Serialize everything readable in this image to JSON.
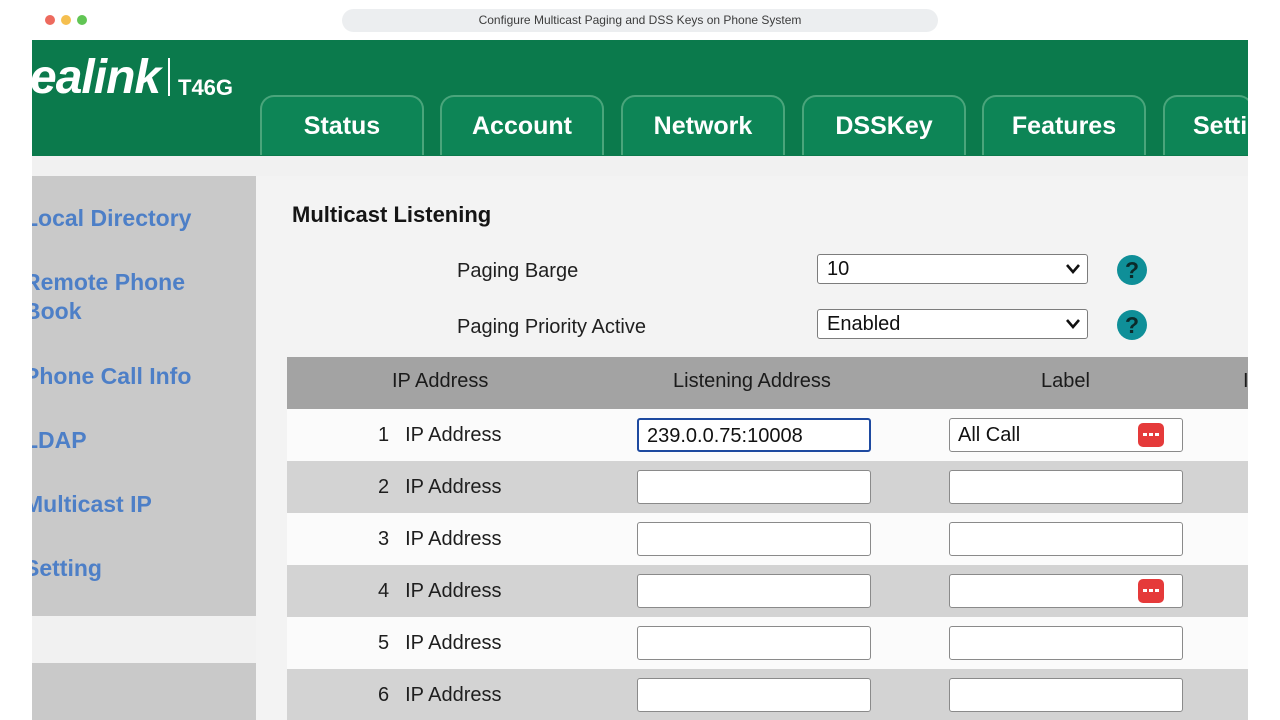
{
  "window": {
    "title": "Configure Multicast Paging and DSS Keys on Phone System",
    "traffic_lights": [
      "#ed6a5e",
      "#f5bf4f",
      "#61c554"
    ]
  },
  "header": {
    "brand": "ealink",
    "model": "T46G",
    "tabs": [
      {
        "label": "Status"
      },
      {
        "label": "Account"
      },
      {
        "label": "Network"
      },
      {
        "label": "DSSKey"
      },
      {
        "label": "Features"
      },
      {
        "label": "Setti"
      }
    ]
  },
  "sidebar": {
    "items": [
      {
        "label_lines": [
          "Local Directory"
        ]
      },
      {
        "label_lines": [
          "Remote Phone",
          "Book"
        ]
      },
      {
        "label_lines": [
          "Phone Call Info"
        ]
      },
      {
        "label_lines": [
          "LDAP"
        ]
      },
      {
        "label_lines": [
          "Multicast IP"
        ],
        "active": true
      },
      {
        "label_lines": [
          "Setting"
        ]
      }
    ]
  },
  "main": {
    "section_title": "Multicast Listening",
    "paging_barge": {
      "label": "Paging Barge",
      "value": "10"
    },
    "paging_priority": {
      "label": "Paging Priority Active",
      "value": "Enabled"
    },
    "help_icon_glyph": "?",
    "table": {
      "headers": [
        "IP Address",
        "Listening Address",
        "Label",
        "I"
      ],
      "rows": [
        {
          "num": "1",
          "label": "IP Address",
          "address": "239.0.0.75:10008",
          "channel_label": "All Call"
        },
        {
          "num": "2",
          "label": "IP Address",
          "address": "",
          "channel_label": ""
        },
        {
          "num": "3",
          "label": "IP Address",
          "address": "",
          "channel_label": ""
        },
        {
          "num": "4",
          "label": "IP Address",
          "address": "",
          "channel_label": ""
        },
        {
          "num": "5",
          "label": "IP Address",
          "address": "",
          "channel_label": ""
        },
        {
          "num": "6",
          "label": "IP Address",
          "address": "",
          "channel_label": ""
        }
      ]
    }
  },
  "colors": {
    "header_green": "#0b7a4c",
    "tab_green": "#0d8556",
    "sidebar_link": "#4d7fc7",
    "help_teal": "#0f8f98",
    "password_icon_red": "#e53a3a"
  }
}
